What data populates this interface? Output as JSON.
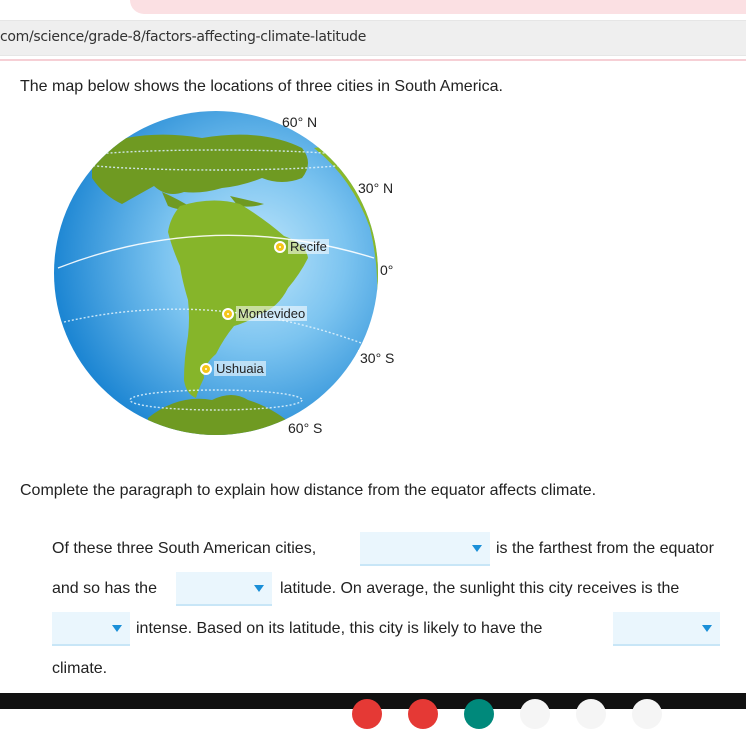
{
  "browser": {
    "url": "com/science/grade-8/factors-affecting-climate-latitude"
  },
  "intro_text": "The map below shows the locations of three cities in South America.",
  "map": {
    "latitude_labels": [
      "60° N",
      "30° N",
      "0°",
      "30° S",
      "60° S"
    ],
    "cities": [
      {
        "name": "Recife"
      },
      {
        "name": "Montevideo"
      },
      {
        "name": "Ushuaia"
      }
    ]
  },
  "question_text": "Complete the paragraph to explain how distance from the equator affects climate.",
  "paragraph": {
    "line1_start": "Of these three South American cities,",
    "line1_end": "is the farthest from the equator",
    "line2_start": "and so has the",
    "line2_end": "latitude. On average, the sunlight this city receives is the",
    "line3_end": "intense. Based on its latitude, this city is likely to have the",
    "line4": "climate.",
    "dropdowns": [
      {
        "selected": ""
      },
      {
        "selected": ""
      },
      {
        "selected": ""
      },
      {
        "selected": ""
      }
    ]
  },
  "colors": {
    "ocean": "#2a94dc",
    "land": "#8ab92a",
    "dropdown_bg": "#eaf6fd",
    "caret": "#1a8fd8",
    "city_dot": "#f5c518"
  }
}
